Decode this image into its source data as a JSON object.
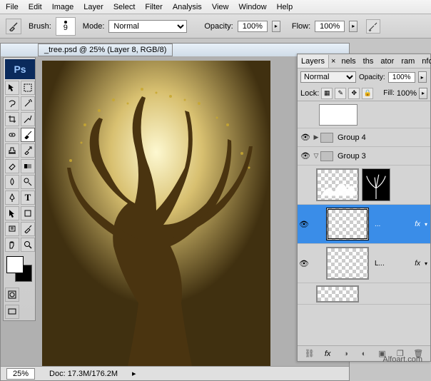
{
  "menu": [
    "File",
    "Edit",
    "Image",
    "Layer",
    "Select",
    "Filter",
    "Analysis",
    "View",
    "Window",
    "Help"
  ],
  "options": {
    "brush_label": "Brush:",
    "brush_size": "9",
    "mode_label": "Mode:",
    "mode_value": "Normal",
    "opacity_label": "Opacity:",
    "opacity_value": "100%",
    "flow_label": "Flow:",
    "flow_value": "100%"
  },
  "document": {
    "title": "_tree.psd @ 25% (Layer 8, RGB/8)"
  },
  "status": {
    "zoom": "25%",
    "doc": "Doc: 17.3M/176.2M"
  },
  "layers_panel": {
    "tabs": [
      "Layers",
      "nels",
      "ths",
      "ator",
      "ram",
      "nfo"
    ],
    "blend_label": "Normal",
    "opacity_label": "Opacity:",
    "opacity_value": "100%",
    "lock_label": "Lock:",
    "fill_label": "Fill:",
    "fill_value": "100%",
    "group4": "Group 4",
    "group3": "Group 3",
    "sel_txt": "...",
    "row_l": "L...",
    "fx": "fx"
  },
  "ps": "Ps",
  "watermark": "Alfoart.com"
}
